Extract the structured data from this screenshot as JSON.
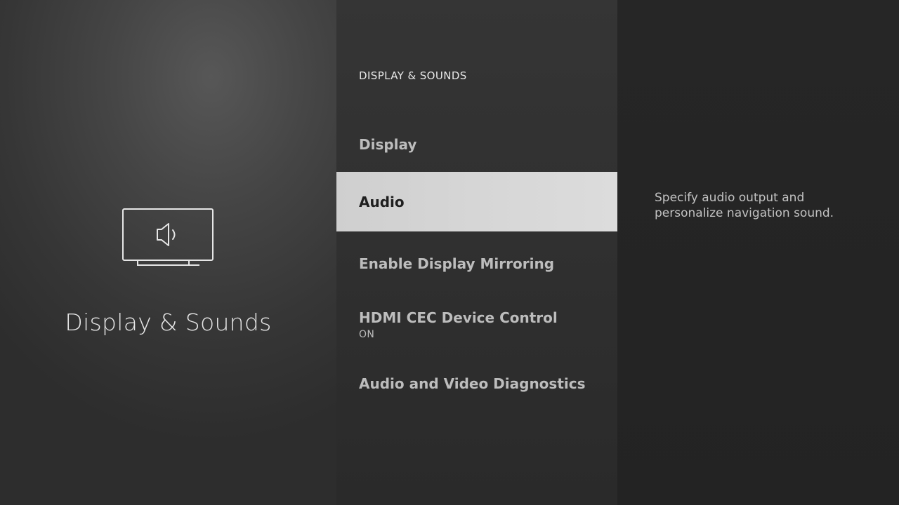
{
  "left": {
    "category_title": "Display & Sounds",
    "icon": "tv-speaker-icon"
  },
  "menu": {
    "header": "DISPLAY & SOUNDS",
    "selected_index": 1,
    "items": [
      {
        "label": "Display"
      },
      {
        "label": "Audio"
      },
      {
        "label": "Enable Display Mirroring"
      },
      {
        "label": "HDMI CEC Device Control",
        "sub": "ON"
      },
      {
        "label": "Audio and Video Diagnostics"
      }
    ]
  },
  "right": {
    "description": "Specify audio output and personalize navigation sound."
  },
  "colors": {
    "selected_bg": "#d6d6d6",
    "selected_text": "#1f1f1f",
    "item_text": "#bdbdbd"
  }
}
